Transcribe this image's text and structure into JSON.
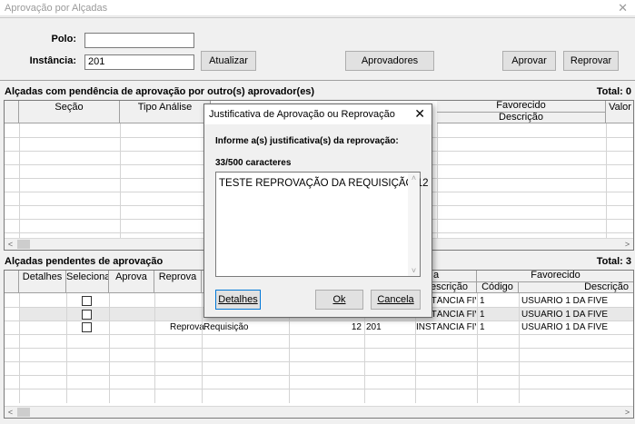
{
  "window": {
    "title": "Aprovação por Alçadas",
    "close_glyph": "✕"
  },
  "form": {
    "polo_label": "Polo:",
    "polo_value": "",
    "instancia_label": "Instância:",
    "instancia_value": "201",
    "atualizar_label": "Atualizar",
    "aprovadores_label": "Aprovadores",
    "aprovar_label": "Aprovar",
    "reprovar_label": "Reprovar"
  },
  "section1": {
    "title": "Alçadas com pendência de aprovação por outro(s) aprovador(es)",
    "total": "Total: 0",
    "headers": {
      "secao": "Seção",
      "tipo_analise": "Tipo Análise",
      "favorecido": "Favorecido",
      "descricao": "Descrição",
      "valor": "Valor"
    }
  },
  "section2": {
    "title": "Alçadas pendentes de aprovação",
    "total": "Total: 3",
    "headers": {
      "detalhes": "Detalhes",
      "selecionar": "Selecionar",
      "aprova": "Aprova",
      "reprova": "Reprova",
      "instancia_partial": "a",
      "descricao": "Descrição",
      "favorecido": "Favorecido",
      "codigo": "Código",
      "fav_descricao": "Descrição"
    },
    "rows": [
      {
        "reprova": "",
        "tipo": "",
        "num": "",
        "inst": "",
        "inst_desc": "INSTÂNCIA FIVE",
        "codigo": "1",
        "fav_desc": "USUÁRIO 1 DA FIVE"
      },
      {
        "reprova": "",
        "tipo": "",
        "num": "",
        "inst": "",
        "inst_desc": "INSTÂNCIA FIVE",
        "codigo": "1",
        "fav_desc": "USUÁRIO 1 DA FIVE"
      },
      {
        "reprova": "Reprova",
        "tipo": "Requisição",
        "num": "12",
        "inst": "201",
        "inst_desc": "INSTÂNCIA FIVE",
        "codigo": "1",
        "fav_desc": "USUÁRIO 1 DA FIVE"
      }
    ]
  },
  "dialog": {
    "title": "Justificativa de Aprovação ou Reprovação",
    "close_glyph": "✕",
    "prompt": "Informe a(s) justificativa(s) da reprovação:",
    "counter": "33/500 caracteres",
    "text": "TESTE REPROVAÇÃO DA REQUISIÇÃO 12",
    "detalhes_label": "Detalhes",
    "ok_label": "Ok",
    "cancela_label": "Cancela"
  },
  "icons": {
    "scroll_left": "<",
    "scroll_right": ">",
    "scroll_up": "˄",
    "scroll_down": "˅"
  }
}
